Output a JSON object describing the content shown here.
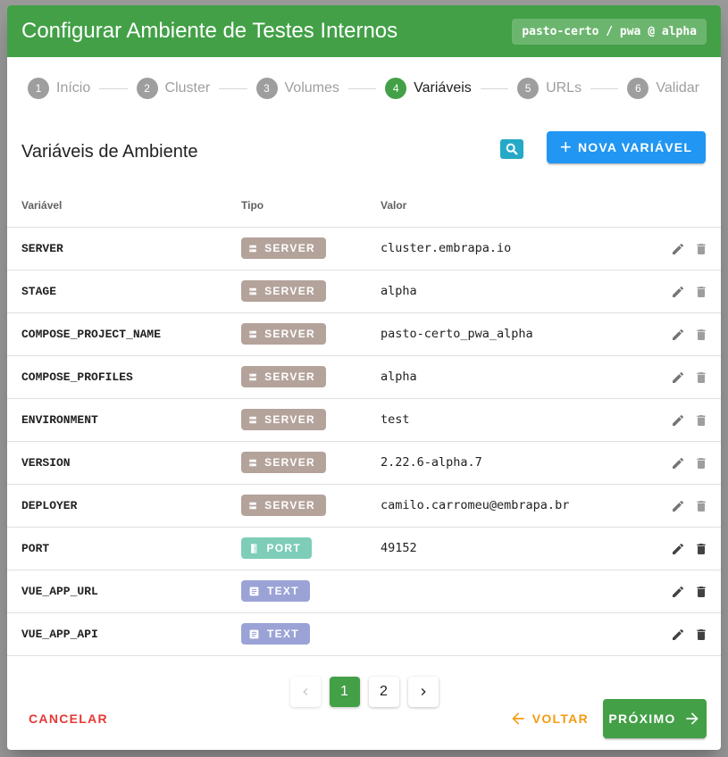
{
  "dialog": {
    "title": "Configurar Ambiente de Testes Internos",
    "chip": "pasto-certo / pwa @ alpha"
  },
  "steps": [
    {
      "num": "1",
      "label": "Início"
    },
    {
      "num": "2",
      "label": "Cluster"
    },
    {
      "num": "3",
      "label": "Volumes"
    },
    {
      "num": "4",
      "label": "Variáveis",
      "active": true
    },
    {
      "num": "5",
      "label": "URLs"
    },
    {
      "num": "6",
      "label": "Validar"
    }
  ],
  "toolbar": {
    "title": "Variáveis de Ambiente",
    "new_label": "NOVA VARIÁVEL",
    "search_icon": "search-icon"
  },
  "table": {
    "headers": {
      "name": "Variável",
      "type": "Tipo",
      "value": "Valor"
    },
    "rows": [
      {
        "name": "SERVER",
        "type": "SERVER",
        "value": "cluster.embrapa.io"
      },
      {
        "name": "STAGE",
        "type": "SERVER",
        "value": "alpha"
      },
      {
        "name": "COMPOSE_PROJECT_NAME",
        "type": "SERVER",
        "value": "pasto-certo_pwa_alpha"
      },
      {
        "name": "COMPOSE_PROFILES",
        "type": "SERVER",
        "value": "alpha"
      },
      {
        "name": "ENVIRONMENT",
        "type": "SERVER",
        "value": "test"
      },
      {
        "name": "VERSION",
        "type": "SERVER",
        "value": "2.22.6-alpha.7"
      },
      {
        "name": "DEPLOYER",
        "type": "SERVER",
        "value": "camilo.carromeu@embrapa.br"
      },
      {
        "name": "PORT",
        "type": "PORT",
        "value": "49152"
      },
      {
        "name": "VUE_APP_URL",
        "type": "TEXT",
        "value": ""
      },
      {
        "name": "VUE_APP_API",
        "type": "TEXT",
        "value": ""
      }
    ]
  },
  "pagination": {
    "pages": [
      "1",
      "2"
    ],
    "current": "1"
  },
  "footer": {
    "cancel_label": "CANCELAR",
    "back_label": "VOLTAR",
    "next_label": "PRÓXIMO"
  },
  "colors": {
    "header": "#43a047",
    "primary": "#2196f3",
    "server_chip": "#b4a39b",
    "port_chip": "#7ecdb8",
    "text_chip": "#9ba3d6",
    "cancel": "#e53935",
    "back": "#f39c12"
  }
}
